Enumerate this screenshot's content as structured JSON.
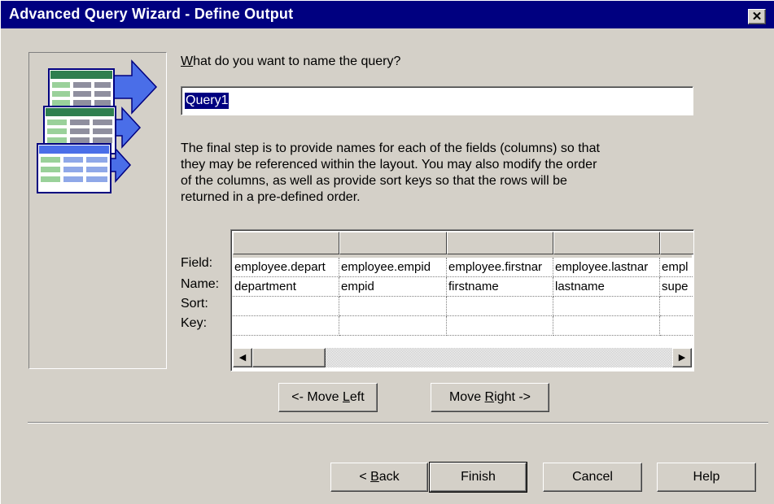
{
  "window": {
    "title": "Advanced Query Wizard - Define Output",
    "close_icon": "close-icon"
  },
  "query_name": {
    "prompt_prefix": "",
    "prompt_u": "W",
    "prompt_rest": "hat do you want to name the query?",
    "value": "Query1"
  },
  "description": [
    "The final step is to provide names for each of the fields (columns) so that",
    "they may be referenced within the layout.  You may also modify the order",
    "of the columns, as well as provide sort keys so that the rows will be",
    "returned in a pre-defined order."
  ],
  "grid": {
    "row_labels": [
      "Field:",
      "Name:",
      "Sort:",
      "Key:"
    ],
    "columns": [
      {
        "field": "employee.depart",
        "name": "department",
        "sort": "",
        "key": ""
      },
      {
        "field": "employee.empid",
        "name": "empid",
        "sort": "",
        "key": ""
      },
      {
        "field": "employee.firstnar",
        "name": "firstname",
        "sort": "",
        "key": ""
      },
      {
        "field": "employee.lastnar",
        "name": "lastname",
        "sort": "",
        "key": ""
      },
      {
        "field": "empl",
        "name": "supe",
        "sort": "",
        "key": ""
      }
    ]
  },
  "move_buttons": {
    "left": {
      "pre": "<- Move ",
      "u": "L",
      "post": "eft"
    },
    "right": {
      "pre": "Move ",
      "u": "R",
      "post": "ight ->"
    }
  },
  "footer_buttons": {
    "back": {
      "pre": "< ",
      "u": "B",
      "post": "ack"
    },
    "finish": "Finish",
    "cancel": "Cancel",
    "help": "Help"
  }
}
